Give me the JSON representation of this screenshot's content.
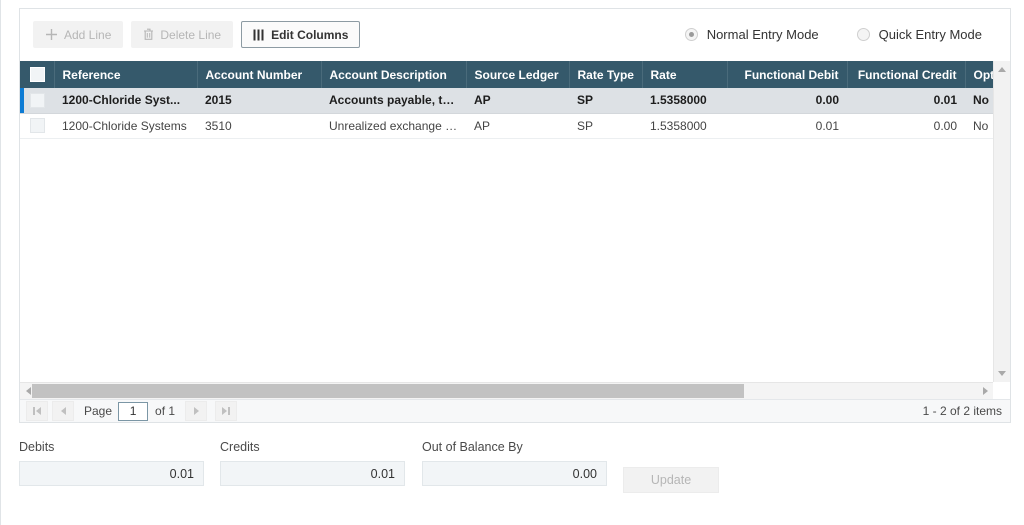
{
  "toolbar": {
    "add_line": "Add Line",
    "delete_line": "Delete Line",
    "edit_columns": "Edit Columns"
  },
  "entry_mode": {
    "normal": "Normal Entry Mode",
    "quick": "Quick Entry Mode",
    "selected": "Normal Entry Mode"
  },
  "grid": {
    "columns": [
      {
        "key": "reference",
        "label": "Reference",
        "align": "left"
      },
      {
        "key": "account_number",
        "label": "Account Number",
        "align": "left"
      },
      {
        "key": "account_description",
        "label": "Account Description",
        "align": "left"
      },
      {
        "key": "source_ledger",
        "label": "Source Ledger",
        "align": "left"
      },
      {
        "key": "rate_type",
        "label": "Rate Type",
        "align": "left"
      },
      {
        "key": "rate",
        "label": "Rate",
        "align": "left"
      },
      {
        "key": "functional_debit",
        "label": "Functional Debit",
        "align": "right"
      },
      {
        "key": "functional_credit",
        "label": "Functional Credit",
        "align": "right"
      },
      {
        "key": "optional",
        "label": "Opti",
        "align": "left"
      }
    ],
    "rows": [
      {
        "selected": true,
        "reference": "1200-Chloride Syst...",
        "account_number": "2015",
        "account_description": "Accounts payable, trade",
        "source_ledger": "AP",
        "rate_type": "SP",
        "rate": "1.5358000",
        "functional_debit": "0.00",
        "functional_credit": "0.01",
        "optional": "No"
      },
      {
        "selected": false,
        "reference": "1200-Chloride Systems",
        "account_number": "3510",
        "account_description": "Unrealized exchange loss",
        "source_ledger": "AP",
        "rate_type": "SP",
        "rate": "1.5358000",
        "functional_debit": "0.01",
        "functional_credit": "0.00",
        "optional": "No"
      }
    ]
  },
  "pager": {
    "page_label": "Page",
    "page_value": "1",
    "of_label": "of 1",
    "items_label": "1 - 2 of 2 items"
  },
  "footer": {
    "debits_label": "Debits",
    "debits_value": "0.01",
    "credits_label": "Credits",
    "credits_value": "0.01",
    "out_of_balance_label": "Out of Balance By",
    "out_of_balance_value": "0.00",
    "update_label": "Update"
  },
  "colors": {
    "header_bg": "#35596b",
    "selected_row_bg": "#dde1e5",
    "selection_marker": "#0c7bd4",
    "field_bg": "#f2f5f7"
  }
}
